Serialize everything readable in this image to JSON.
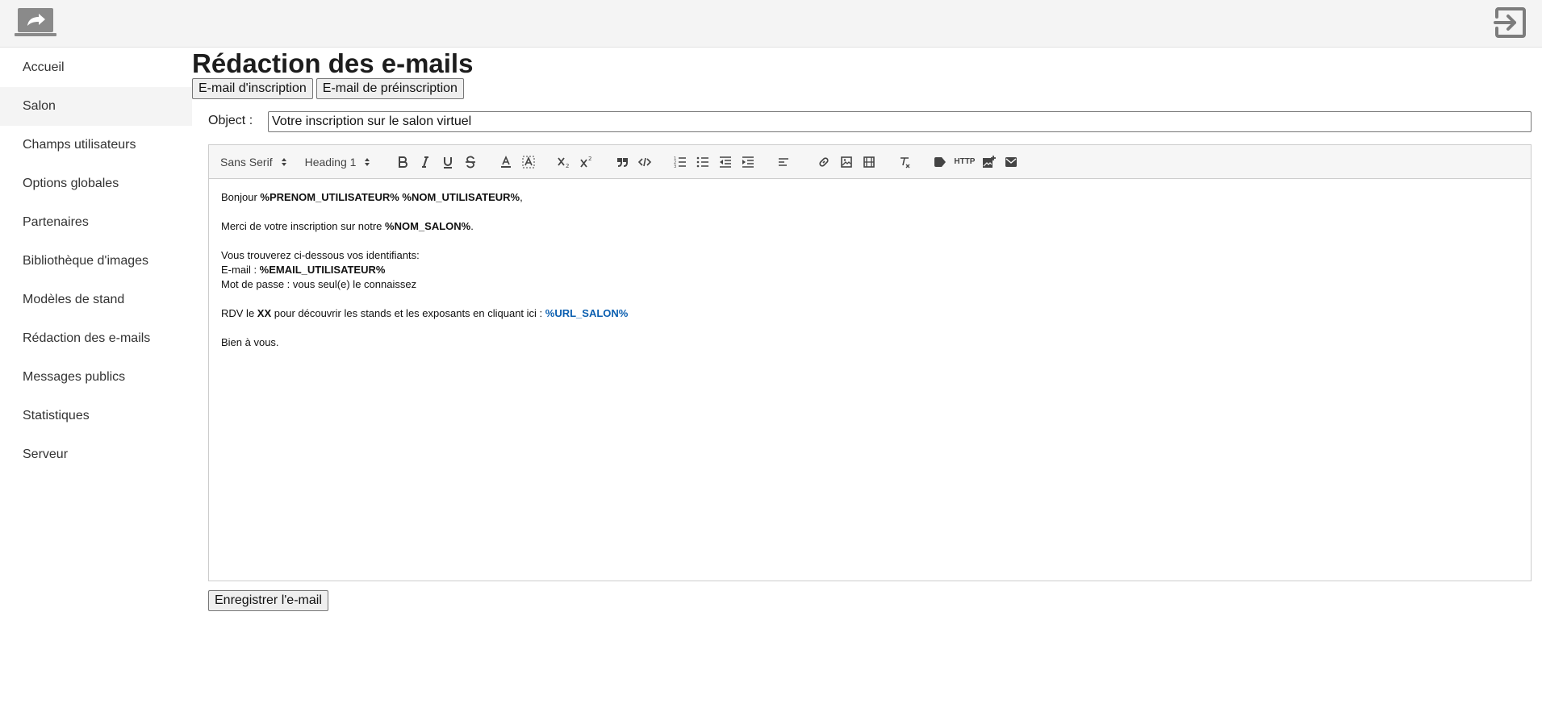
{
  "header": {
    "logo_icon": "share-laptop-icon",
    "logout_icon": "logout-icon"
  },
  "sidebar": {
    "items": [
      {
        "label": "Accueil",
        "active": false
      },
      {
        "label": "Salon",
        "active": true
      },
      {
        "label": "Champs utilisateurs",
        "active": false
      },
      {
        "label": "Options globales",
        "active": false
      },
      {
        "label": "Partenaires",
        "active": false
      },
      {
        "label": "Bibliothèque d'images",
        "active": false
      },
      {
        "label": "Modèles de stand",
        "active": false
      },
      {
        "label": "Rédaction des e-mails",
        "active": false
      },
      {
        "label": "Messages publics",
        "active": false
      },
      {
        "label": "Statistiques",
        "active": false
      },
      {
        "label": "Serveur",
        "active": false
      }
    ]
  },
  "main": {
    "title": "Rédaction des e-mails",
    "tabs": [
      "E-mail d'inscription",
      "E-mail de préinscription"
    ],
    "object_label": "Object :",
    "object_value": "Votre inscription sur le salon virtuel",
    "save_label": "Enregistrer l'e-mail"
  },
  "toolbar": {
    "font": "Sans Serif",
    "heading": "Heading 1",
    "http_label": "HTTP"
  },
  "email_body": {
    "l1_a": "Bonjour ",
    "l1_b": "%PRENOM_UTILISATEUR% %NOM_UTILISATEUR%",
    "l1_c": ",",
    "l2_a": "Merci de votre inscription sur notre ",
    "l2_b": "%NOM_SALON%",
    "l2_c": ".",
    "l3": "Vous trouverez ci-dessous vos identifiants:",
    "l4_a": "E-mail : ",
    "l4_b": "%EMAIL_UTILISATEUR%",
    "l5": "Mot de passe : vous seul(e) le connaissez",
    "l6_a": "RDV le ",
    "l6_b": "XX",
    "l6_c": " pour découvrir les stands et les exposants en cliquant ici : ",
    "l6_d": "%URL_SALON%",
    "l7": "Bien à vous."
  },
  "colors": {
    "link": "#0b5fb0",
    "sidebar_active": "#f4f4f4",
    "topbar": "#f4f4f4"
  }
}
